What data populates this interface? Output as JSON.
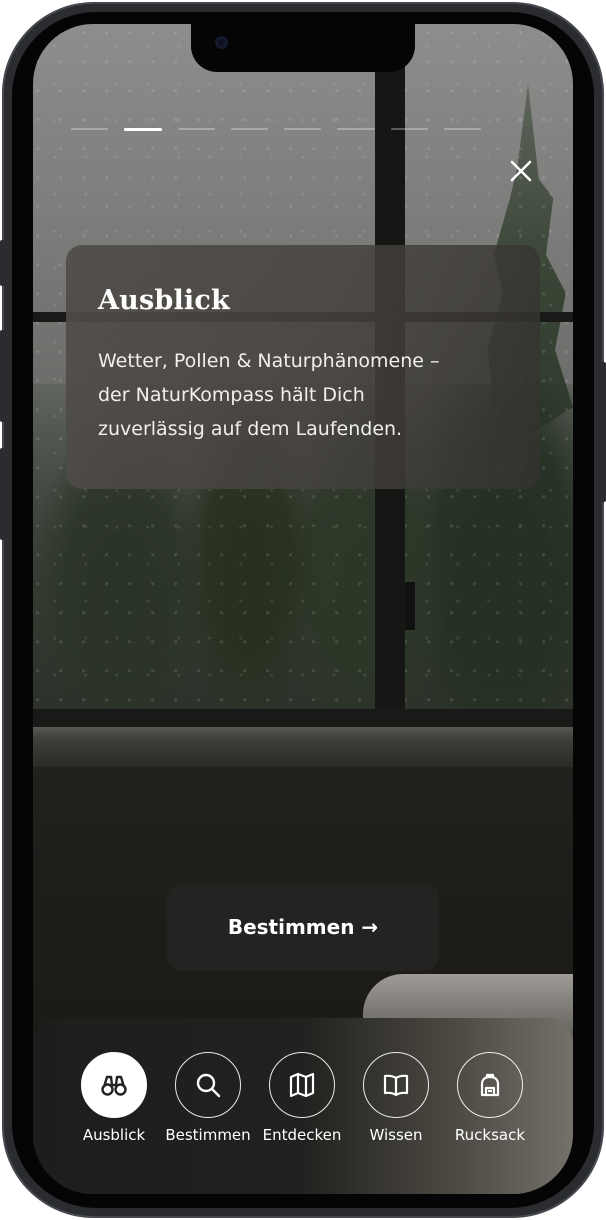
{
  "story": {
    "segments_total": 8,
    "active_segment": 2
  },
  "card": {
    "title": "Ausblick",
    "text": "Wetter, Pollen & Naturphänomene –\nder NaturKompass hält Dich\nzuverlässig auf dem Laufenden."
  },
  "primary_button": {
    "label": "Bestimmen →"
  },
  "tabs": [
    {
      "label": "Ausblick",
      "icon": "binoculars-icon",
      "active": true
    },
    {
      "label": "Bestimmen",
      "icon": "search-icon",
      "active": false
    },
    {
      "label": "Entdecken",
      "icon": "map-icon",
      "active": false
    },
    {
      "label": "Wissen",
      "icon": "book-icon",
      "active": false
    },
    {
      "label": "Rucksack",
      "icon": "backpack-icon",
      "active": false
    }
  ],
  "colors": {
    "accent": "#ffffff",
    "card_bg": "#4f4b47",
    "button_bg": "#252321",
    "tabbar_bg": "#1e1d1b"
  }
}
